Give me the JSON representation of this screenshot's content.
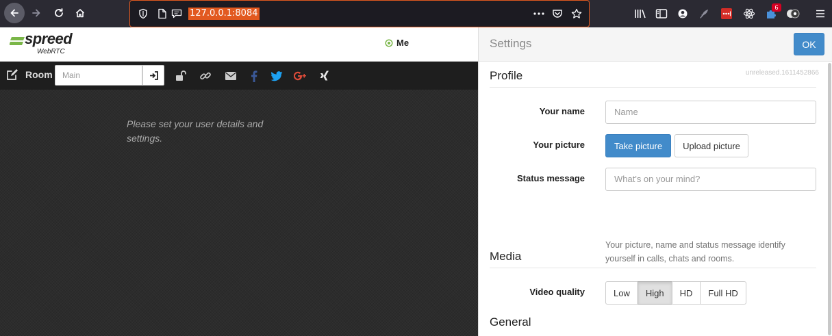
{
  "browser": {
    "url": "127.0.0.1:8084",
    "notification_count": "6"
  },
  "app": {
    "logo_brand": "spreed",
    "logo_sub": "WebRTC",
    "me_label": "Me",
    "accent_color": "#428bca",
    "status_color": "#7ab648"
  },
  "toolbar": {
    "room_label": "Room",
    "room_placeholder": "Main",
    "icons": [
      "edit-icon",
      "sign-in-icon",
      "unlock-icon",
      "link-icon",
      "envelope-icon",
      "facebook-icon",
      "twitter-icon",
      "google-plus-icon",
      "xing-icon"
    ]
  },
  "main": {
    "message": "Please set your user details and settings."
  },
  "settings": {
    "title": "Settings",
    "ok_label": "OK",
    "version": "unreleased.1611452866",
    "profile": {
      "heading": "Profile",
      "name_label": "Your name",
      "name_placeholder": "Name",
      "picture_label": "Your picture",
      "take_picture": "Take picture",
      "upload_picture": "Upload picture",
      "status_label": "Status message",
      "status_placeholder": "What's on your mind?",
      "help": "Your picture, name and status message identify yourself in calls, chats and rooms."
    },
    "media": {
      "heading": "Media",
      "video_quality_label": "Video quality",
      "options": [
        "Low",
        "High",
        "HD",
        "Full HD"
      ],
      "selected": "High"
    },
    "general": {
      "heading": "General"
    }
  }
}
